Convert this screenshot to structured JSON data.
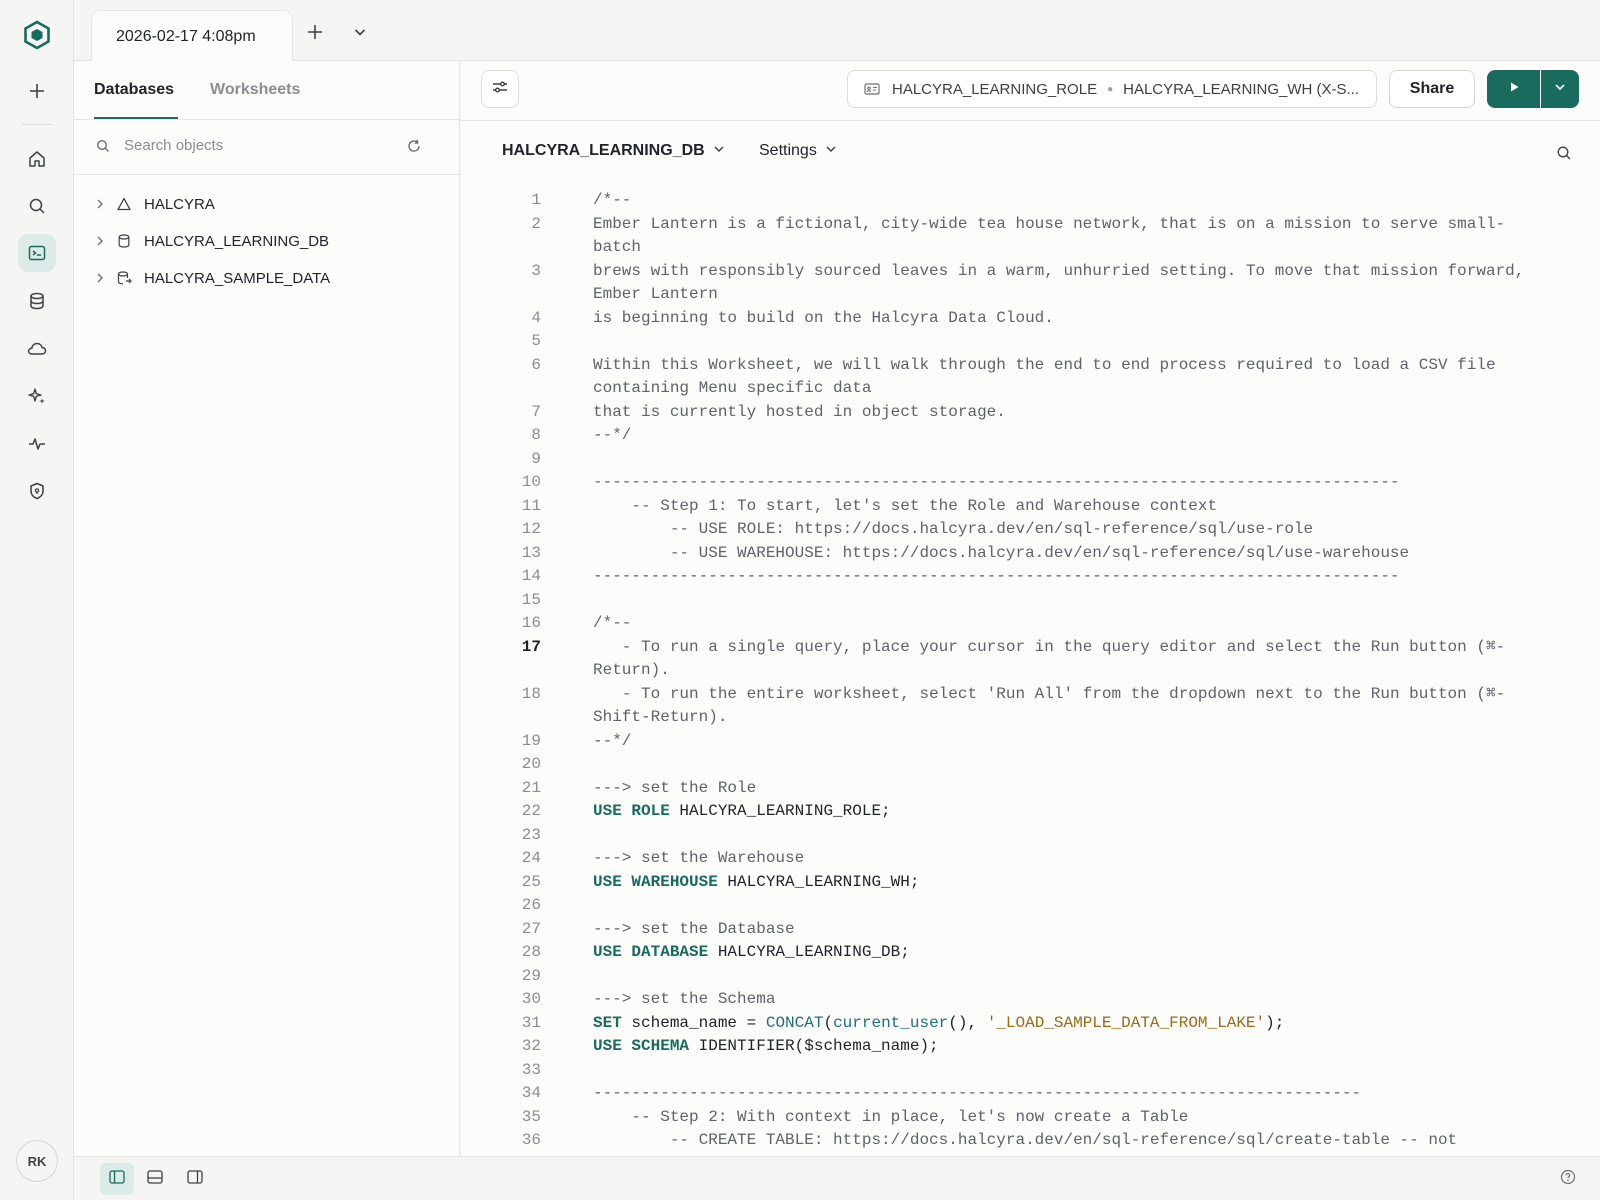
{
  "rail": {
    "logo": "hexagon-logo-icon",
    "items": [
      {
        "name": "plus-icon"
      },
      {
        "name": "home-icon"
      },
      {
        "name": "search-icon"
      },
      {
        "name": "worksheet-icon",
        "active": true
      },
      {
        "name": "database-icon"
      },
      {
        "name": "cloud-icon"
      },
      {
        "name": "sparkle-icon"
      },
      {
        "name": "activity-icon"
      },
      {
        "name": "shield-icon"
      }
    ],
    "avatar_initials": "RK"
  },
  "tabstrip": {
    "active_tab": "2026-02-17 4:08pm"
  },
  "object_panel": {
    "tabs": [
      "Databases",
      "Worksheets"
    ],
    "search_placeholder": "Search objects",
    "tree": [
      {
        "label": "HALCYRA",
        "icon": "triangle-icon"
      },
      {
        "label": "HALCYRA_LEARNING_DB",
        "icon": "database-icon"
      },
      {
        "label": "HALCYRA_SAMPLE_DATA",
        "icon": "shared-database-icon"
      }
    ]
  },
  "toolbar": {
    "role": "HALCYRA_LEARNING_ROLE",
    "warehouse": "HALCYRA_LEARNING_WH (X-S...",
    "share_label": "Share"
  },
  "context": {
    "database": "HALCYRA_LEARNING_DB",
    "settings_label": "Settings"
  },
  "editor": {
    "current_line": 17,
    "lines": [
      {
        "n": 1,
        "parts": [
          {
            "t": "/*--",
            "k": "c"
          }
        ]
      },
      {
        "n": 2,
        "parts": [
          {
            "t": "Ember Lantern is a fictional, city-wide tea house network, that is on a mission to serve small-batch",
            "k": "c"
          }
        ]
      },
      {
        "n": 3,
        "parts": [
          {
            "t": "brews with responsibly sourced leaves in a warm, unhurried setting. To move that mission forward, Ember Lantern",
            "k": "c"
          }
        ]
      },
      {
        "n": 4,
        "parts": [
          {
            "t": "is beginning to build on the Halcyra Data Cloud.",
            "k": "c"
          }
        ]
      },
      {
        "n": 5,
        "parts": [
          {
            "t": "",
            "k": "c"
          }
        ]
      },
      {
        "n": 6,
        "parts": [
          {
            "t": "Within this Worksheet, we will walk through the end to end process required to load a CSV file containing Menu specific data",
            "k": "c"
          }
        ]
      },
      {
        "n": 7,
        "parts": [
          {
            "t": "that is currently hosted in object storage.",
            "k": "c"
          }
        ]
      },
      {
        "n": 8,
        "parts": [
          {
            "t": "--*/",
            "k": "c"
          }
        ]
      },
      {
        "n": 9,
        "parts": [
          {
            "t": "",
            "k": "c"
          }
        ]
      },
      {
        "n": 10,
        "parts": [
          {
            "t": "------------------------------------------------------------------------------------",
            "k": "c"
          }
        ]
      },
      {
        "n": 11,
        "parts": [
          {
            "t": "    -- Step 1: To start, let's set the Role and Warehouse context",
            "k": "c"
          }
        ]
      },
      {
        "n": 12,
        "parts": [
          {
            "t": "        -- USE ROLE: https://docs.halcyra.dev/en/sql-reference/sql/use-role",
            "k": "c"
          }
        ]
      },
      {
        "n": 13,
        "parts": [
          {
            "t": "        -- USE WAREHOUSE: https://docs.halcyra.dev/en/sql-reference/sql/use-warehouse",
            "k": "c"
          }
        ]
      },
      {
        "n": 14,
        "parts": [
          {
            "t": "------------------------------------------------------------------------------------",
            "k": "c"
          }
        ]
      },
      {
        "n": 15,
        "parts": [
          {
            "t": "",
            "k": "c"
          }
        ]
      },
      {
        "n": 16,
        "parts": [
          {
            "t": "/*--",
            "k": "c"
          }
        ]
      },
      {
        "n": 17,
        "parts": [
          {
            "t": "   - To run a single query, place your cursor in the query editor and select the Run button (⌘-Return).",
            "k": "c"
          }
        ]
      },
      {
        "n": 18,
        "parts": [
          {
            "t": "   - To run the entire worksheet, select 'Run All' from the dropdown next to the Run button (⌘-Shift-Return).",
            "k": "c"
          }
        ]
      },
      {
        "n": 19,
        "parts": [
          {
            "t": "--*/",
            "k": "c"
          }
        ]
      },
      {
        "n": 20,
        "parts": [
          {
            "t": "",
            "k": "c"
          }
        ]
      },
      {
        "n": 21,
        "parts": [
          {
            "t": "---> set the Role",
            "k": "c"
          }
        ]
      },
      {
        "n": 22,
        "parts": [
          {
            "t": "USE ROLE",
            "k": "kw"
          },
          {
            "t": " HALCYRA_LEARNING_ROLE;",
            "k": "plain"
          }
        ]
      },
      {
        "n": 23,
        "parts": [
          {
            "t": "",
            "k": "c"
          }
        ]
      },
      {
        "n": 24,
        "parts": [
          {
            "t": "---> set the Warehouse",
            "k": "c"
          }
        ]
      },
      {
        "n": 25,
        "parts": [
          {
            "t": "USE WAREHOUSE",
            "k": "kw"
          },
          {
            "t": " HALCYRA_LEARNING_WH;",
            "k": "plain"
          }
        ]
      },
      {
        "n": 26,
        "parts": [
          {
            "t": "",
            "k": "c"
          }
        ]
      },
      {
        "n": 27,
        "parts": [
          {
            "t": "---> set the Database",
            "k": "c"
          }
        ]
      },
      {
        "n": 28,
        "parts": [
          {
            "t": "USE DATABASE",
            "k": "kw"
          },
          {
            "t": " HALCYRA_LEARNING_DB;",
            "k": "plain"
          }
        ]
      },
      {
        "n": 29,
        "parts": [
          {
            "t": "",
            "k": "c"
          }
        ]
      },
      {
        "n": 30,
        "parts": [
          {
            "t": "---> set the Schema",
            "k": "c"
          }
        ]
      },
      {
        "n": 31,
        "parts": [
          {
            "t": "SET",
            "k": "kw"
          },
          {
            "t": " schema_name = ",
            "k": "plain"
          },
          {
            "t": "CONCAT",
            "k": "fn"
          },
          {
            "t": "(",
            "k": "plain"
          },
          {
            "t": "current_user",
            "k": "fn"
          },
          {
            "t": "(), ",
            "k": "plain"
          },
          {
            "t": "'_LOAD_SAMPLE_DATA_FROM_LAKE'",
            "k": "str"
          },
          {
            "t": ");",
            "k": "plain"
          }
        ]
      },
      {
        "n": 32,
        "parts": [
          {
            "t": "USE SCHEMA",
            "k": "kw"
          },
          {
            "t": " IDENTIFIER($schema_name);",
            "k": "plain"
          }
        ]
      },
      {
        "n": 33,
        "parts": [
          {
            "t": "",
            "k": "c"
          }
        ]
      },
      {
        "n": 34,
        "parts": [
          {
            "t": "--------------------------------------------------------------------------------",
            "k": "c"
          }
        ]
      },
      {
        "n": 35,
        "parts": [
          {
            "t": "    -- Step 2: With context in place, let's now create a Table",
            "k": "c"
          }
        ]
      },
      {
        "n": 36,
        "parts": [
          {
            "t": "        -- CREATE TABLE: https://docs.halcyra.dev/en/sql-reference/sql/create-table -- not",
            "k": "c"
          }
        ]
      }
    ]
  },
  "bottombar": {
    "buttons": [
      {
        "name": "layout-sidebar-icon",
        "active": true
      },
      {
        "name": "layout-bottom-panel-icon"
      },
      {
        "name": "layout-right-panel-icon"
      }
    ],
    "help": "help-icon"
  },
  "colors": {
    "accent": "#196b5e",
    "keyword": "#196b5e",
    "function": "#1f6e7a",
    "string": "#9a6a14",
    "comment": "#5f6368"
  }
}
